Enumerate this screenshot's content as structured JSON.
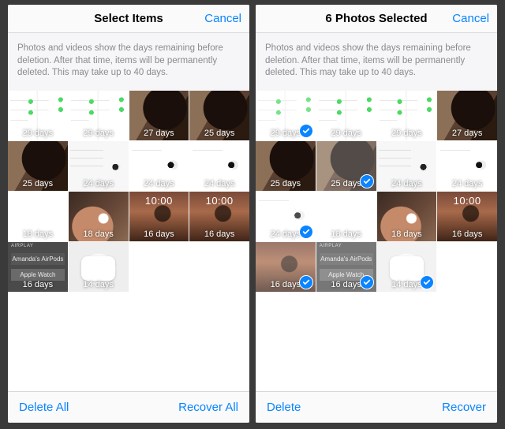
{
  "left": {
    "title": "Select Items",
    "cancel": "Cancel",
    "info": "Photos and videos show the days remaining before deletion. After that time, items will be permanently deleted. This may take up to 40 days.",
    "toolbar": {
      "left": "Delete All",
      "right": "Recover All"
    },
    "airplay": {
      "header": "AIRPLAY",
      "item1": "Amanda's AirPods",
      "item2": "Apple Watch"
    },
    "days": {
      "r1c1": "29 days",
      "r1c2": "29 days",
      "r1c3": "27 days",
      "r1c4": "25 days",
      "r2c1": "25 days",
      "r2c2": "24 days",
      "r2c3": "24 days",
      "r2c4": "24 days",
      "r3c1": "18 days",
      "r3c2": "18 days",
      "r3c3": "16 days",
      "r3c4": "16 days",
      "r4c1": "16 days",
      "r4c2": "14 days"
    }
  },
  "right": {
    "title": "6 Photos Selected",
    "cancel": "Cancel",
    "info": "Photos and videos show the days remaining before deletion. After that time, items will be permanently deleted. This may take up to 40 days.",
    "toolbar": {
      "left": "Delete",
      "right": "Recover"
    },
    "airplay": {
      "header": "AIRPLAY",
      "item1": "Amanda's AirPods",
      "item2": "Apple Watch"
    },
    "days": {
      "r1c1": "29 days",
      "r1c2": "29 days",
      "r1c3": "29 days",
      "r1c4": "27 days",
      "r2c1": "25 days",
      "r2c2": "25 days",
      "r2c3": "24 days",
      "r2c4": "24 days",
      "r3c1": "24 days",
      "r3c2": "18 days",
      "r3c3": "18 days",
      "r3c4": "16 days",
      "r4c1": "16 days",
      "r4c2": "16 days",
      "r4c3": "14 days"
    }
  }
}
